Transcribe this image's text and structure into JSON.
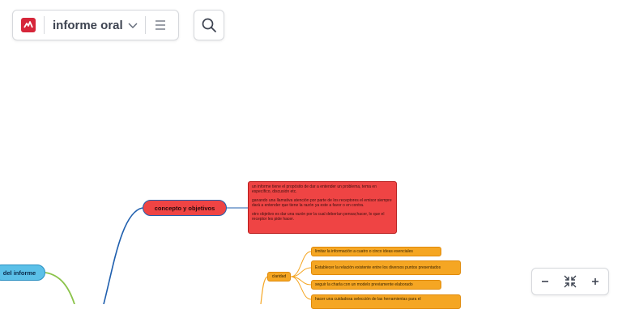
{
  "toolbar": {
    "title": "informe oral"
  },
  "colors": {
    "brand": "#d6263a",
    "red_node": "#ef4444",
    "red_border": "#b91c1c",
    "orange_node": "#f5a623",
    "orange_border": "#e08a0a",
    "blue_node": "#5bc0e8",
    "blue_line": "#1f5fae",
    "green_line": "#8bc34a"
  },
  "map": {
    "left_topic": "del informe",
    "concept_topic": "concepto y objetivos",
    "concept_note": {
      "p1": "un informe tiene el propósito de dar a entender un problema, tema en específico, discusión etc.",
      "p2": "ganando una llamativa atención por parte de los receptores el emisor siempre dará a entender que tiene la razón ya este a favor o en contra.",
      "p3": "otro objetivo es dar una razón por la cual deberían pensar,hacer, lo que el receptor les pide hacer."
    },
    "claridad_topic": "claridad",
    "claridad_items": [
      "limitar la información a cuatro o cinco ideas esenciales",
      "Establecer la relación existente entre los diversos puntos presentados",
      "seguir la charla con un modelo previamente elaborado",
      "hacer una cuidadosa selección de las herramientas para el"
    ]
  }
}
